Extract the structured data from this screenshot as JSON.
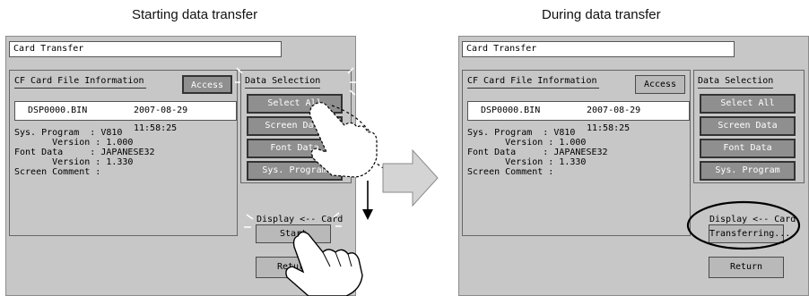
{
  "captions": {
    "left": "Starting data transfer",
    "right": "During data transfer"
  },
  "screens": [
    {
      "title": "Card Transfer",
      "info_heading": "CF Card File Information",
      "access_label": "Access",
      "file": {
        "name": "DSP0000.BIN",
        "datetime": "2007-08-29  11:58:25"
      },
      "details": "Sys. Program  : V810\n       Version : 1.000\nFont Data     : JAPANESE32\n       Version : 1.330\nScreen Comment :",
      "selection_heading": "Data Selection",
      "selection_buttons": [
        "Select All",
        "Screen Data",
        "Font Data",
        "Sys. Program"
      ],
      "display_label": "Display <-- Card",
      "start_label": "Start",
      "return_label": "Return"
    },
    {
      "title": "Card Transfer",
      "info_heading": "CF Card File Information",
      "access_label": "Access",
      "file": {
        "name": "DSP0000.BIN",
        "datetime": "2007-08-29  11:58:25"
      },
      "details": "Sys. Program  : V810\n       Version : 1.000\nFont Data     : JAPANESE32\n       Version : 1.330\nScreen Comment :",
      "selection_heading": "Data Selection",
      "selection_buttons": [
        "Select All",
        "Screen Data",
        "Font Data",
        "Sys. Program"
      ],
      "display_label": "Display <-- Card",
      "start_label": "Transferring...",
      "return_label": "Return"
    }
  ],
  "colors": {
    "panel": "#c7c7c7",
    "button_selected": "#8f8f8f",
    "button": "#b9b9b9",
    "highlight_ellipse": "#000000"
  },
  "icons": [
    "hand-pointer-icon",
    "right-arrow-icon",
    "down-arrow-icon"
  ]
}
